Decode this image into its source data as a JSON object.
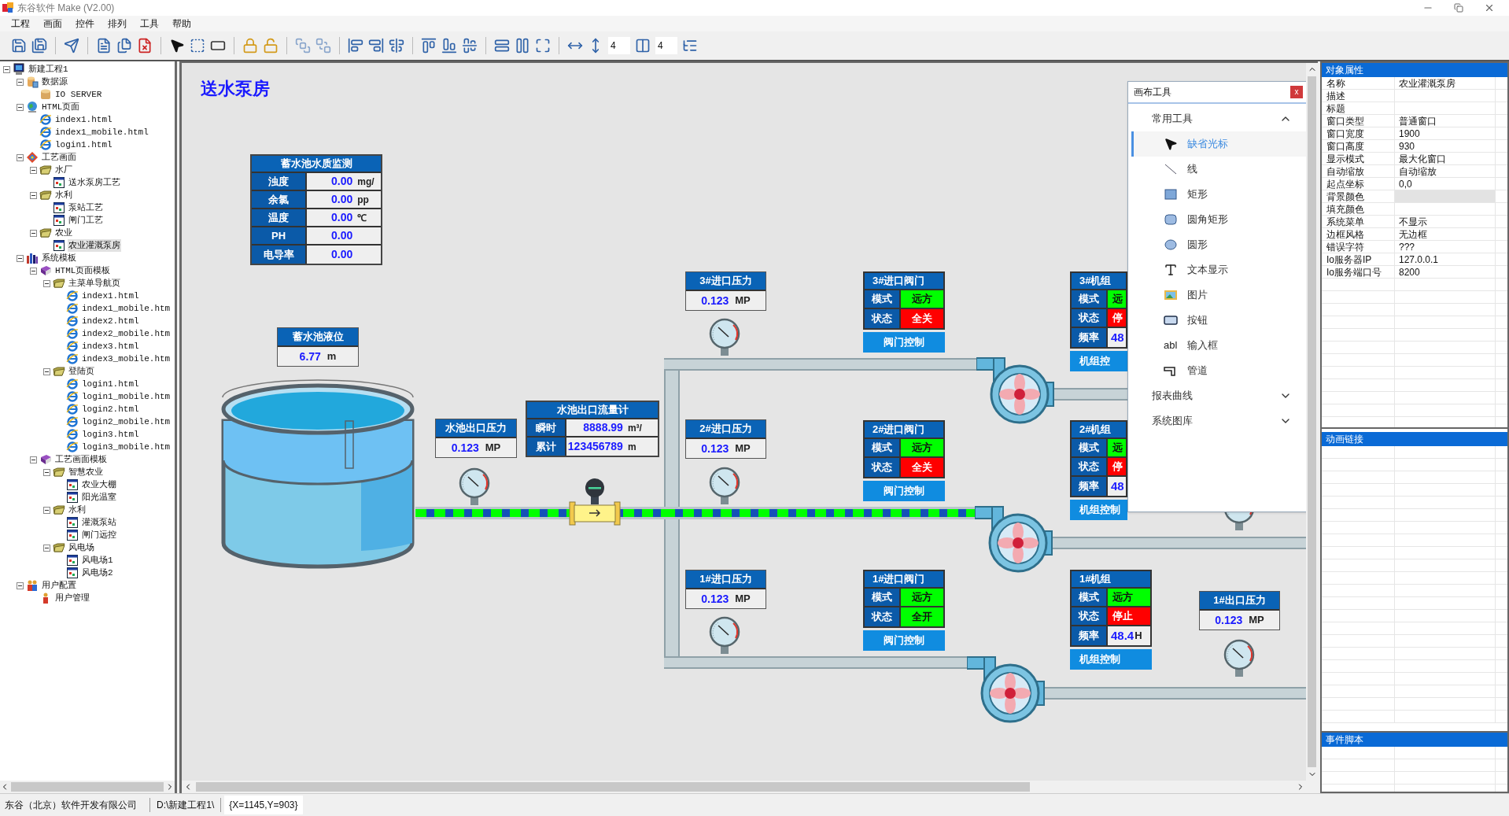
{
  "window": {
    "title": "东谷软件 Make (V2.00)"
  },
  "menu": [
    "工程",
    "画面",
    "控件",
    "排列",
    "工具",
    "帮助"
  ],
  "toolbar": {
    "fields": [
      "4",
      "4"
    ]
  },
  "tree": [
    {
      "label": "新建工程1",
      "kind": "computer",
      "selected": false,
      "expanded": true,
      "children": [
        {
          "label": "数据源",
          "kind": "database",
          "selected": false,
          "expanded": true,
          "children": [
            {
              "label": "IO SERVER",
              "kind": "server",
              "selected": false
            }
          ]
        },
        {
          "label": "HTML页面",
          "kind": "globe",
          "selected": false,
          "expanded": true,
          "children": [
            {
              "label": "index1.html",
              "kind": "web",
              "selected": false
            },
            {
              "label": "index1_mobile.html",
              "kind": "web",
              "selected": false
            },
            {
              "label": "login1.html",
              "kind": "web",
              "selected": false
            }
          ]
        },
        {
          "label": "工艺画面",
          "kind": "process",
          "selected": false,
          "expanded": true,
          "children": [
            {
              "label": "水厂",
              "kind": "folder",
              "selected": false,
              "expanded": true,
              "children": [
                {
                  "label": "送水泵房工艺",
                  "kind": "screen",
                  "selected": false
                }
              ]
            },
            {
              "label": "水利",
              "kind": "folder",
              "selected": false,
              "expanded": true,
              "children": [
                {
                  "label": "泵站工艺",
                  "kind": "screen",
                  "selected": false
                },
                {
                  "label": "闸门工艺",
                  "kind": "screen",
                  "selected": false
                }
              ]
            },
            {
              "label": "农业",
              "kind": "folder",
              "selected": false,
              "expanded": true,
              "children": [
                {
                  "label": "农业灌溉泵房",
                  "kind": "screen",
                  "selected": true
                }
              ]
            }
          ]
        },
        {
          "label": "系统模板",
          "kind": "books",
          "selected": false,
          "expanded": true,
          "children": [
            {
              "label": "HTML页面模板",
              "kind": "book",
              "selected": false,
              "expanded": true,
              "children": [
                {
                  "label": "主菜单导航页",
                  "kind": "folder",
                  "selected": false,
                  "expanded": true,
                  "children": [
                    {
                      "label": "index1.html",
                      "kind": "web",
                      "selected": false
                    },
                    {
                      "label": "index1_mobile.htm",
                      "kind": "web",
                      "selected": false
                    },
                    {
                      "label": "index2.html",
                      "kind": "web",
                      "selected": false
                    },
                    {
                      "label": "index2_mobile.htm",
                      "kind": "web",
                      "selected": false
                    },
                    {
                      "label": "index3.html",
                      "kind": "web",
                      "selected": false
                    },
                    {
                      "label": "index3_mobile.htm",
                      "kind": "web",
                      "selected": false
                    }
                  ]
                },
                {
                  "label": "登陆页",
                  "kind": "folder",
                  "selected": false,
                  "expanded": true,
                  "children": [
                    {
                      "label": "login1.html",
                      "kind": "web",
                      "selected": false
                    },
                    {
                      "label": "login1_mobile.htm",
                      "kind": "web",
                      "selected": false
                    },
                    {
                      "label": "login2.html",
                      "kind": "web",
                      "selected": false
                    },
                    {
                      "label": "login2_mobile.htm",
                      "kind": "web",
                      "selected": false
                    },
                    {
                      "label": "login3.html",
                      "kind": "web",
                      "selected": false
                    },
                    {
                      "label": "login3_mobile.htm",
                      "kind": "web",
                      "selected": false
                    }
                  ]
                }
              ]
            },
            {
              "label": "工艺画面模板",
              "kind": "book",
              "selected": false,
              "expanded": true,
              "children": [
                {
                  "label": "智慧农业",
                  "kind": "folder",
                  "selected": false,
                  "expanded": true,
                  "children": [
                    {
                      "label": "农业大棚",
                      "kind": "screen",
                      "selected": false
                    },
                    {
                      "label": "阳光温室",
                      "kind": "screen",
                      "selected": false
                    }
                  ]
                },
                {
                  "label": "水利",
                  "kind": "folder",
                  "selected": false,
                  "expanded": true,
                  "children": [
                    {
                      "label": "灌溉泵站",
                      "kind": "screen",
                      "selected": false
                    },
                    {
                      "label": "闸门远控",
                      "kind": "screen",
                      "selected": false
                    }
                  ]
                },
                {
                  "label": "风电场",
                  "kind": "folder",
                  "selected": false,
                  "expanded": true,
                  "children": [
                    {
                      "label": "风电场1",
                      "kind": "screen",
                      "selected": false
                    },
                    {
                      "label": "风电场2",
                      "kind": "screen",
                      "selected": false
                    }
                  ]
                }
              ]
            }
          ]
        },
        {
          "label": "用户配置",
          "kind": "users",
          "selected": false,
          "expanded": true,
          "children": [
            {
              "label": "用户管理",
              "kind": "user",
              "selected": false
            }
          ]
        }
      ]
    }
  ],
  "canvas": {
    "title": "送水泵房",
    "quality_table": {
      "title": "蓄水池水质监测",
      "rows": [
        {
          "label": "浊度",
          "value": "0.00",
          "unit": "mg/"
        },
        {
          "label": "余氯",
          "value": "0.00",
          "unit": "pp"
        },
        {
          "label": "温度",
          "value": "0.00",
          "unit": "℃"
        },
        {
          "label": "PH",
          "value": "0.00"
        },
        {
          "label": "电导率",
          "value": "0.00"
        }
      ]
    },
    "tank_level": {
      "title": "蓄水池液位",
      "value": "6.77",
      "unit": "m"
    },
    "outlet_pressure": {
      "title": "水池出口压力",
      "value": "0.123",
      "unit": "MP"
    },
    "flowmeter": {
      "title": "水池出口流量计",
      "rows": [
        {
          "label": "瞬时",
          "value": "8888.99",
          "unit": "m³/"
        },
        {
          "label": "累计",
          "value": "123456789",
          "unit": "m"
        }
      ]
    },
    "main_pipe": {
      "flowing": true
    },
    "branches": [
      {
        "flowing": false,
        "pressure": {
          "title": "3#进口压力",
          "value": "0.123",
          "unit": "MP"
        },
        "valve": {
          "title": "3#进口阀门",
          "rows": [
            {
              "label": "模式",
              "value": "远方",
              "color": "#00ff00"
            },
            {
              "label": "状态",
              "value": "全关",
              "color": "#ff0000"
            }
          ],
          "button": "阀门控制"
        },
        "unit": {
          "title": "3#机组",
          "rows": [
            {
              "kind": "state",
              "label": "模式",
              "value": "远",
              "color": "#00ff00"
            },
            {
              "kind": "state",
              "label": "状态",
              "value": "停",
              "color": "#ff0000"
            },
            {
              "kind": "reading",
              "label": "频率",
              "value": "48"
            }
          ],
          "button": "机组控"
        }
      },
      {
        "flowing": true,
        "pressure": {
          "title": "2#进口压力",
          "value": "0.123",
          "unit": "MP"
        },
        "valve": {
          "title": "2#进口阀门",
          "rows": [
            {
              "label": "模式",
              "value": "远方",
              "color": "#00ff00"
            },
            {
              "label": "状态",
              "value": "全关",
              "color": "#ff0000"
            }
          ],
          "button": "阀门控制"
        },
        "unit": {
          "title": "2#机组",
          "rows": [
            {
              "kind": "state",
              "label": "模式",
              "value": "远",
              "color": "#00ff00"
            },
            {
              "kind": "state",
              "label": "状态",
              "value": "停",
              "color": "#ff0000"
            },
            {
              "kind": "reading",
              "label": "频率",
              "value": "48"
            }
          ],
          "button": "机组控制"
        }
      },
      {
        "flowing": false,
        "pressure": {
          "title": "1#进口压力",
          "value": "0.123",
          "unit": "MP"
        },
        "valve": {
          "title": "1#进口阀门",
          "rows": [
            {
              "label": "模式",
              "value": "远方",
              "color": "#00ff00"
            },
            {
              "label": "状态",
              "value": "全开",
              "color": "#00ff00"
            }
          ],
          "button": "阀门控制"
        },
        "unit": {
          "title": "1#机组",
          "rows": [
            {
              "kind": "state",
              "label": "模式",
              "value": "远方",
              "color": "#00ff00"
            },
            {
              "kind": "state",
              "label": "状态",
              "value": "停止",
              "color": "#ff0000"
            },
            {
              "kind": "reading",
              "label": "频率",
              "value": "48.4",
              "unit": "H"
            }
          ],
          "button": "机组控制"
        }
      }
    ],
    "outlet_pressure_1": {
      "title": "1#出口压力",
      "value": "0.123",
      "unit": "MP"
    }
  },
  "canvas_tools": {
    "title": "画布工具",
    "close": "x",
    "sections": [
      {
        "title": "常用工具",
        "expanded": true,
        "items": [
          {
            "label": "缺省光标",
            "kind": "cursor",
            "selected": true
          },
          {
            "label": "线",
            "kind": "line",
            "selected": false
          },
          {
            "label": "矩形",
            "kind": "rect",
            "selected": false
          },
          {
            "label": "圆角矩形",
            "kind": "roundrect",
            "selected": false
          },
          {
            "label": "圆形",
            "kind": "circle",
            "selected": false
          },
          {
            "label": "文本显示",
            "kind": "text",
            "selected": false
          },
          {
            "label": "图片",
            "kind": "image",
            "selected": false
          },
          {
            "label": "按钮",
            "kind": "button",
            "selected": false
          },
          {
            "label": "输入框",
            "kind": "input",
            "icon_text": "abl",
            "selected": false
          },
          {
            "label": "管道",
            "kind": "pipe",
            "selected": false
          }
        ]
      },
      {
        "title": "报表曲线",
        "expanded": false
      },
      {
        "title": "系统图库",
        "expanded": false
      }
    ]
  },
  "properties": {
    "title": "对象属性",
    "rows": [
      {
        "name": "名称",
        "value": "农业灌溉泵房"
      },
      {
        "name": "描述"
      },
      {
        "name": "标题"
      },
      {
        "name": "窗口类型",
        "value": "普通窗口"
      },
      {
        "name": "窗口宽度",
        "value": "1900"
      },
      {
        "name": "窗口高度",
        "value": "930"
      },
      {
        "name": "显示模式",
        "value": "最大化窗口"
      },
      {
        "name": "自动缩放",
        "value": "自动缩放"
      },
      {
        "name": "起点坐标",
        "value": "0,0"
      },
      {
        "name": "背景颜色",
        "color": "#e3e3e3"
      },
      {
        "name": "填充颜色"
      },
      {
        "name": "系统菜单",
        "value": "不显示"
      },
      {
        "name": "边框风格",
        "value": "无边框"
      },
      {
        "name": "错误字符",
        "value": "???"
      },
      {
        "name": "Io服务器IP",
        "value": "127.0.0.1"
      },
      {
        "name": "Io服务端口号",
        "value": "8200"
      }
    ]
  },
  "animation": {
    "title": "动画链接"
  },
  "events": {
    "title": "事件脚本"
  },
  "status_bar": [
    "东谷（北京）软件开发有限公司",
    "D:\\新建工程1\\",
    "{X=1145,Y=903}"
  ]
}
